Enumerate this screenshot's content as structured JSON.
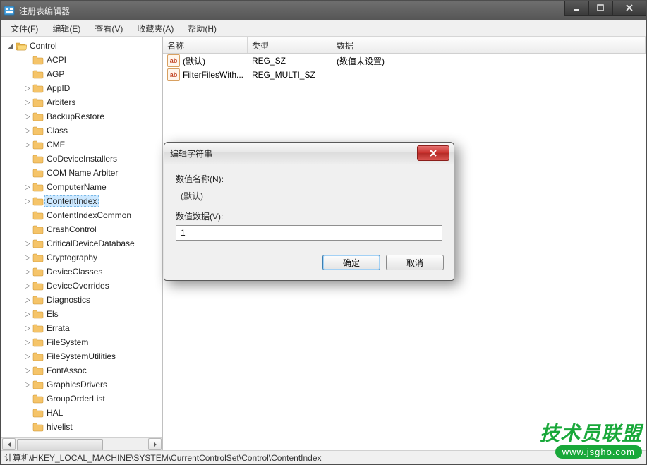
{
  "window": {
    "title": "注册表编辑器"
  },
  "menu": {
    "items": [
      "文件(F)",
      "编辑(E)",
      "查看(V)",
      "收藏夹(A)",
      "帮助(H)"
    ]
  },
  "tree": {
    "root_label": "Control",
    "selected": "ContentIndex",
    "items": [
      {
        "label": "ACPI",
        "expandable": false
      },
      {
        "label": "AGP",
        "expandable": false
      },
      {
        "label": "AppID",
        "expandable": true
      },
      {
        "label": "Arbiters",
        "expandable": true
      },
      {
        "label": "BackupRestore",
        "expandable": true
      },
      {
        "label": "Class",
        "expandable": true
      },
      {
        "label": "CMF",
        "expandable": true
      },
      {
        "label": "CoDeviceInstallers",
        "expandable": false
      },
      {
        "label": "COM Name Arbiter",
        "expandable": false
      },
      {
        "label": "ComputerName",
        "expandable": true
      },
      {
        "label": "ContentIndex",
        "expandable": true,
        "selected": true
      },
      {
        "label": "ContentIndexCommon",
        "expandable": false
      },
      {
        "label": "CrashControl",
        "expandable": false
      },
      {
        "label": "CriticalDeviceDatabase",
        "expandable": true
      },
      {
        "label": "Cryptography",
        "expandable": true
      },
      {
        "label": "DeviceClasses",
        "expandable": true
      },
      {
        "label": "DeviceOverrides",
        "expandable": true
      },
      {
        "label": "Diagnostics",
        "expandable": true
      },
      {
        "label": "Els",
        "expandable": true
      },
      {
        "label": "Errata",
        "expandable": true
      },
      {
        "label": "FileSystem",
        "expandable": true
      },
      {
        "label": "FileSystemUtilities",
        "expandable": true
      },
      {
        "label": "FontAssoc",
        "expandable": true
      },
      {
        "label": "GraphicsDrivers",
        "expandable": true
      },
      {
        "label": "GroupOrderList",
        "expandable": false
      },
      {
        "label": "HAL",
        "expandable": false
      },
      {
        "label": "hivelist",
        "expandable": false
      }
    ]
  },
  "list": {
    "columns": {
      "name": "名称",
      "type": "类型",
      "data": "数据"
    },
    "rows": [
      {
        "name": "(默认)",
        "type": "REG_SZ",
        "data": "(数值未设置)"
      },
      {
        "name": "FilterFilesWith...",
        "type": "REG_MULTI_SZ",
        "data": ""
      }
    ]
  },
  "dialog": {
    "title": "编辑字符串",
    "name_label": "数值名称(N):",
    "name_value": "(默认)",
    "data_label": "数值数据(V):",
    "data_value": "1",
    "ok": "确定",
    "cancel": "取消"
  },
  "statusbar": {
    "path": "计算机\\HKEY_LOCAL_MACHINE\\SYSTEM\\CurrentControlSet\\Control\\ContentIndex"
  },
  "watermark": {
    "text": "技术员联盟",
    "url": "www.jsgho.com"
  }
}
